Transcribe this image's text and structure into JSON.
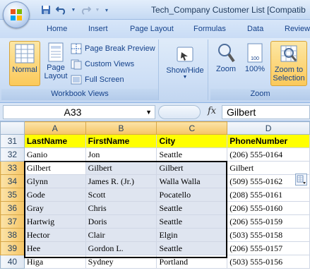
{
  "window": {
    "title": "Tech_Company Customer List  [Compatib"
  },
  "tabs": [
    "Home",
    "Insert",
    "Page Layout",
    "Formulas",
    "Data",
    "Review"
  ],
  "ribbon": {
    "workbook_views": {
      "label": "Workbook Views",
      "normal": "Normal",
      "page_layout": "Page Layout",
      "page_break_preview": "Page Break Preview",
      "custom_views": "Custom Views",
      "full_screen": "Full Screen"
    },
    "show_hide": {
      "label": "Show/Hide"
    },
    "zoom": {
      "label": "Zoom",
      "zoom_btn": "Zoom",
      "zoom100": "100%",
      "zoom_to_selection": "Zoom to Selection"
    }
  },
  "formula_bar": {
    "name_box": "A33",
    "fx": "fx",
    "content": "Gilbert"
  },
  "sheet": {
    "columns": [
      "A",
      "B",
      "C",
      "D"
    ],
    "header_row": {
      "row": "31",
      "cells": [
        "LastName",
        "FirstName",
        "City",
        "PhoneNumber"
      ]
    },
    "rows": [
      {
        "row": "32",
        "cells": [
          "Ganio",
          "Jon",
          "Seattle",
          "(206) 555-0164"
        ]
      },
      {
        "row": "33",
        "cells": [
          "Gilbert",
          "Gilbert",
          "Gilbert",
          "Gilbert"
        ]
      },
      {
        "row": "34",
        "cells": [
          "Glynn",
          "James R. (Jr.)",
          "Walla Walla",
          "(509) 555-0162"
        ]
      },
      {
        "row": "35",
        "cells": [
          "Gode",
          "Scott",
          "Pocatello",
          "(208) 555-0161"
        ]
      },
      {
        "row": "36",
        "cells": [
          "Gray",
          "Chris",
          "Seattle",
          "(206) 555-0160"
        ]
      },
      {
        "row": "37",
        "cells": [
          "Hartwig",
          "Doris",
          "Seattle",
          "(206) 555-0159"
        ]
      },
      {
        "row": "38",
        "cells": [
          "Hector",
          "Clair",
          "Elgin",
          "(503) 555-0158"
        ]
      },
      {
        "row": "39",
        "cells": [
          "Hee",
          "Gordon L.",
          "Seattle",
          "(206) 555-0157"
        ]
      },
      {
        "row": "40",
        "cells": [
          "Higa",
          "Sydney",
          "Portland",
          "(503) 555-0156"
        ]
      }
    ]
  },
  "colors": {
    "header_fill": "#ffff00",
    "selection_fill": "#dfe5f0",
    "active_button": "#fbc95a"
  }
}
